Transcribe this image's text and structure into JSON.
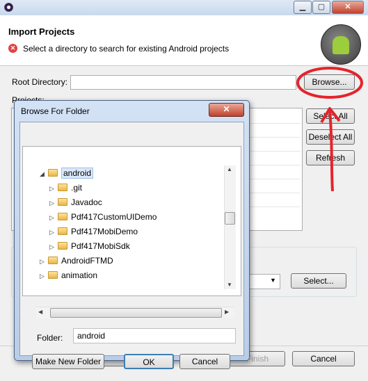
{
  "window": {
    "close_glyph": "✕",
    "minimize_glyph": "▁",
    "maximize_glyph": "▢"
  },
  "header": {
    "title": "Import Projects",
    "error_icon": "✕",
    "message": "Select a directory to search for existing Android projects"
  },
  "form": {
    "root_label": "Root Directory:",
    "root_value": "",
    "browse_button": "Browse...",
    "projects_label": "Projects:",
    "select_all": "Select All",
    "deselect_all": "Deselect All",
    "refresh": "Refresh",
    "select_button": "Select...",
    "finish": "Finish",
    "cancel": "Cancel"
  },
  "dialog": {
    "title": "Browse For Folder",
    "close_glyph": "✕",
    "tree": [
      {
        "label": "android",
        "expanded": true,
        "selected": true,
        "indent": 0
      },
      {
        "label": ".git",
        "expanded": false,
        "selected": false,
        "indent": 1
      },
      {
        "label": "Javadoc",
        "expanded": false,
        "selected": false,
        "indent": 1
      },
      {
        "label": "Pdf417CustomUIDemo",
        "expanded": false,
        "selected": false,
        "indent": 1
      },
      {
        "label": "Pdf417MobiDemo",
        "expanded": false,
        "selected": false,
        "indent": 1
      },
      {
        "label": "Pdf417MobiSdk",
        "expanded": false,
        "selected": false,
        "indent": 1
      },
      {
        "label": "AndroidFTMD",
        "expanded": false,
        "selected": false,
        "indent": 0
      },
      {
        "label": "animation",
        "expanded": false,
        "selected": false,
        "indent": 0
      }
    ],
    "folder_label": "Folder:",
    "folder_value": "android",
    "make_new_folder": "Make New Folder",
    "ok": "OK",
    "cancel": "Cancel"
  },
  "annotation_color": "#e5242b",
  "selection_color": "#dbe9f9"
}
